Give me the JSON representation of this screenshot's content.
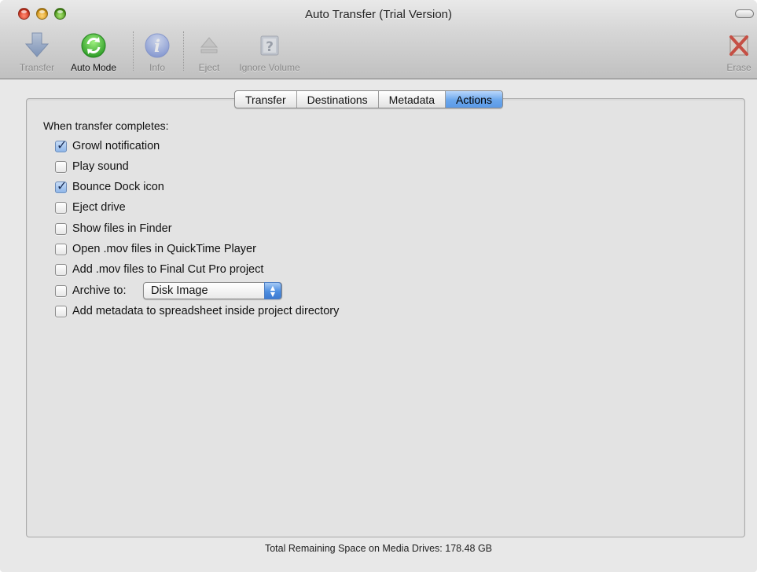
{
  "window": {
    "title": "Auto Transfer (Trial Version)"
  },
  "toolbar": {
    "items": [
      {
        "label": "Transfer",
        "icon": "download-arrow-icon",
        "enabled": false
      },
      {
        "label": "Auto Mode",
        "icon": "auto-mode-refresh-icon",
        "enabled": true
      },
      {
        "label": "Info",
        "icon": "info-icon",
        "enabled": false
      },
      {
        "label": "Eject",
        "icon": "eject-icon",
        "enabled": false
      },
      {
        "label": "Ignore Volume",
        "icon": "ignore-volume-icon",
        "enabled": false
      },
      {
        "label": "Erase",
        "icon": "erase-icon",
        "enabled": false
      }
    ]
  },
  "tabs": [
    {
      "label": "Transfer",
      "selected": false
    },
    {
      "label": "Destinations",
      "selected": false
    },
    {
      "label": "Metadata",
      "selected": false
    },
    {
      "label": "Actions",
      "selected": true
    }
  ],
  "actions": {
    "heading": "When transfer completes:",
    "options": [
      {
        "label": "Growl notification",
        "checked": true
      },
      {
        "label": "Play sound",
        "checked": false
      },
      {
        "label": "Bounce Dock icon",
        "checked": true
      },
      {
        "label": "Eject drive",
        "checked": false
      },
      {
        "label": "Show files in Finder",
        "checked": false
      },
      {
        "label": "Open .mov files in QuickTime Player",
        "checked": false
      },
      {
        "label": "Add .mov files to Final Cut Pro project",
        "checked": false
      },
      {
        "label": "Archive to:",
        "checked": false
      },
      {
        "label": "Add metadata to spreadsheet inside project directory",
        "checked": false
      }
    ],
    "archive_select": {
      "value": "Disk Image"
    }
  },
  "footer": {
    "status": "Total Remaining Space on Media Drives: 178.48 GB"
  },
  "colors": {
    "accent": "#5b9ae6",
    "auto_mode_green": "#3fb83a",
    "info_blue": "#6f8fe0",
    "erase_red": "#c43a2d"
  }
}
